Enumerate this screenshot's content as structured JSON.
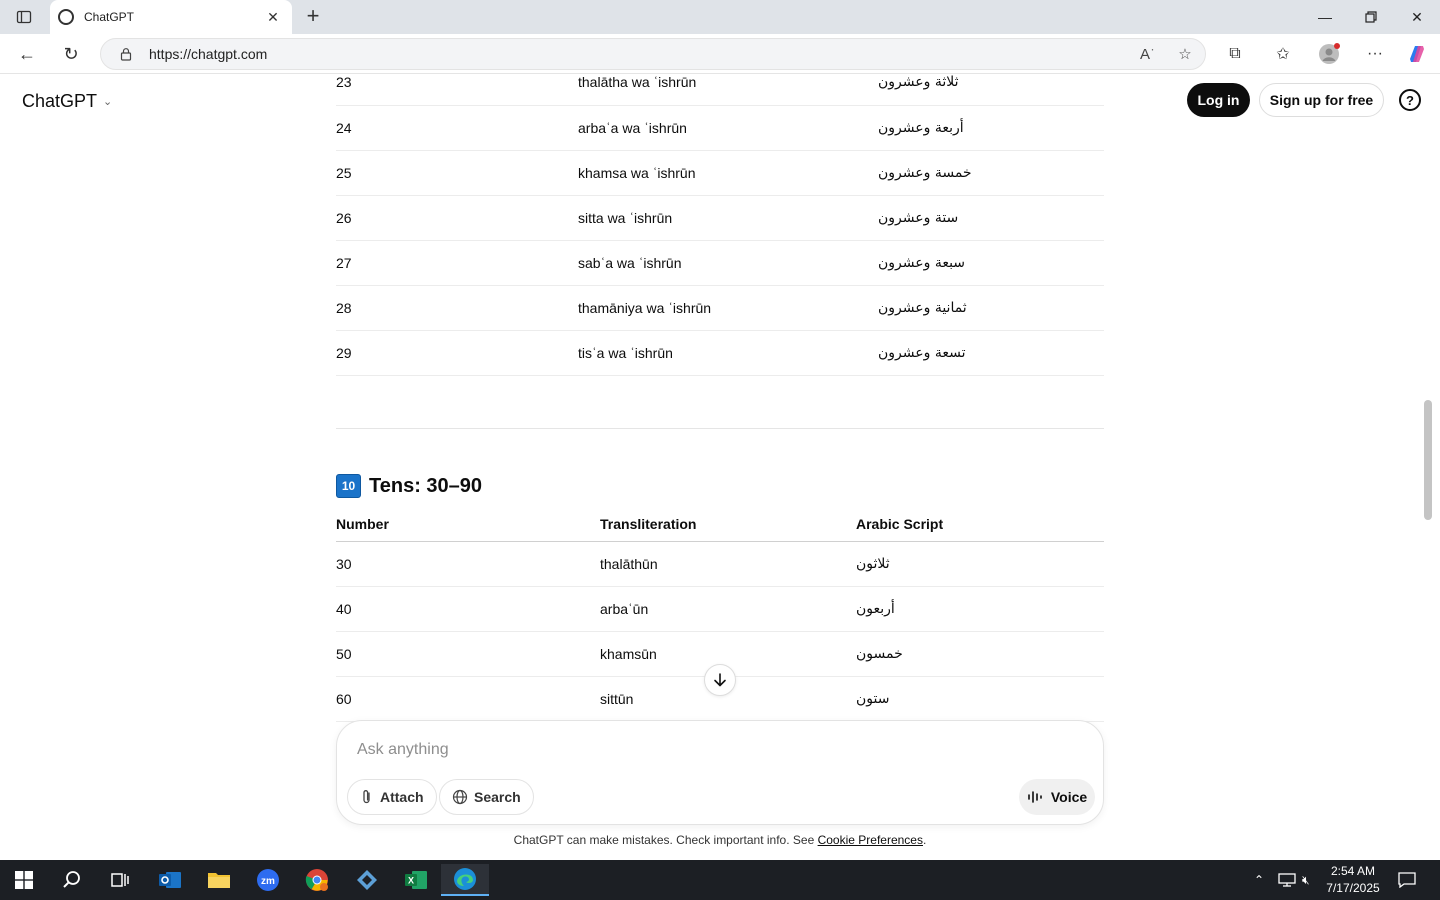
{
  "browser": {
    "tab_title": "ChatGPT",
    "url": "https://chatgpt.com"
  },
  "header": {
    "brand": "ChatGPT",
    "login_label": "Log in",
    "signup_label": "Sign up for free",
    "help_label": "?"
  },
  "table1": {
    "rows": [
      {
        "number": "23",
        "translit": "thalātha wa ʿishrūn",
        "arabic": "ثلاثة وعشرون"
      },
      {
        "number": "24",
        "translit": "arbaʿa wa ʿishrūn",
        "arabic": "أربعة وعشرون"
      },
      {
        "number": "25",
        "translit": "khamsa wa ʿishrūn",
        "arabic": "خمسة وعشرون"
      },
      {
        "number": "26",
        "translit": "sitta wa ʿishrūn",
        "arabic": "ستة وعشرون"
      },
      {
        "number": "27",
        "translit": "sabʿa wa ʿishrūn",
        "arabic": "سبعة وعشرون"
      },
      {
        "number": "28",
        "translit": "thamāniya wa ʿishrūn",
        "arabic": "ثمانية وعشرون"
      },
      {
        "number": "29",
        "translit": "tisʿa wa ʿishrūn",
        "arabic": "تسعة وعشرون"
      }
    ]
  },
  "section2": {
    "keycap": "10",
    "title": "Tens: 30–90",
    "headers": [
      "Number",
      "Transliteration",
      "Arabic Script"
    ],
    "rows": [
      {
        "number": "30",
        "translit": "thalāthūn",
        "arabic": "ثلاثون"
      },
      {
        "number": "40",
        "translit": "arbaʿūn",
        "arabic": "أربعون"
      },
      {
        "number": "50",
        "translit": "khamsūn",
        "arabic": "خمسون"
      },
      {
        "number": "60",
        "translit": "sittūn",
        "arabic": "ستون"
      }
    ]
  },
  "composer": {
    "placeholder": "Ask anything",
    "attach_label": "Attach",
    "search_label": "Search",
    "voice_label": "Voice"
  },
  "footer": {
    "disclaimer": "ChatGPT can make mistakes. Check important info. See ",
    "cookie_link": "Cookie Preferences",
    "period": "."
  },
  "taskbar": {
    "time": "2:54 AM",
    "date": "7/17/2025"
  },
  "colors": {
    "accent_dark": "#0d0d0d",
    "keycap_blue": "#1a73c9",
    "taskbar": "#1c1f24"
  }
}
